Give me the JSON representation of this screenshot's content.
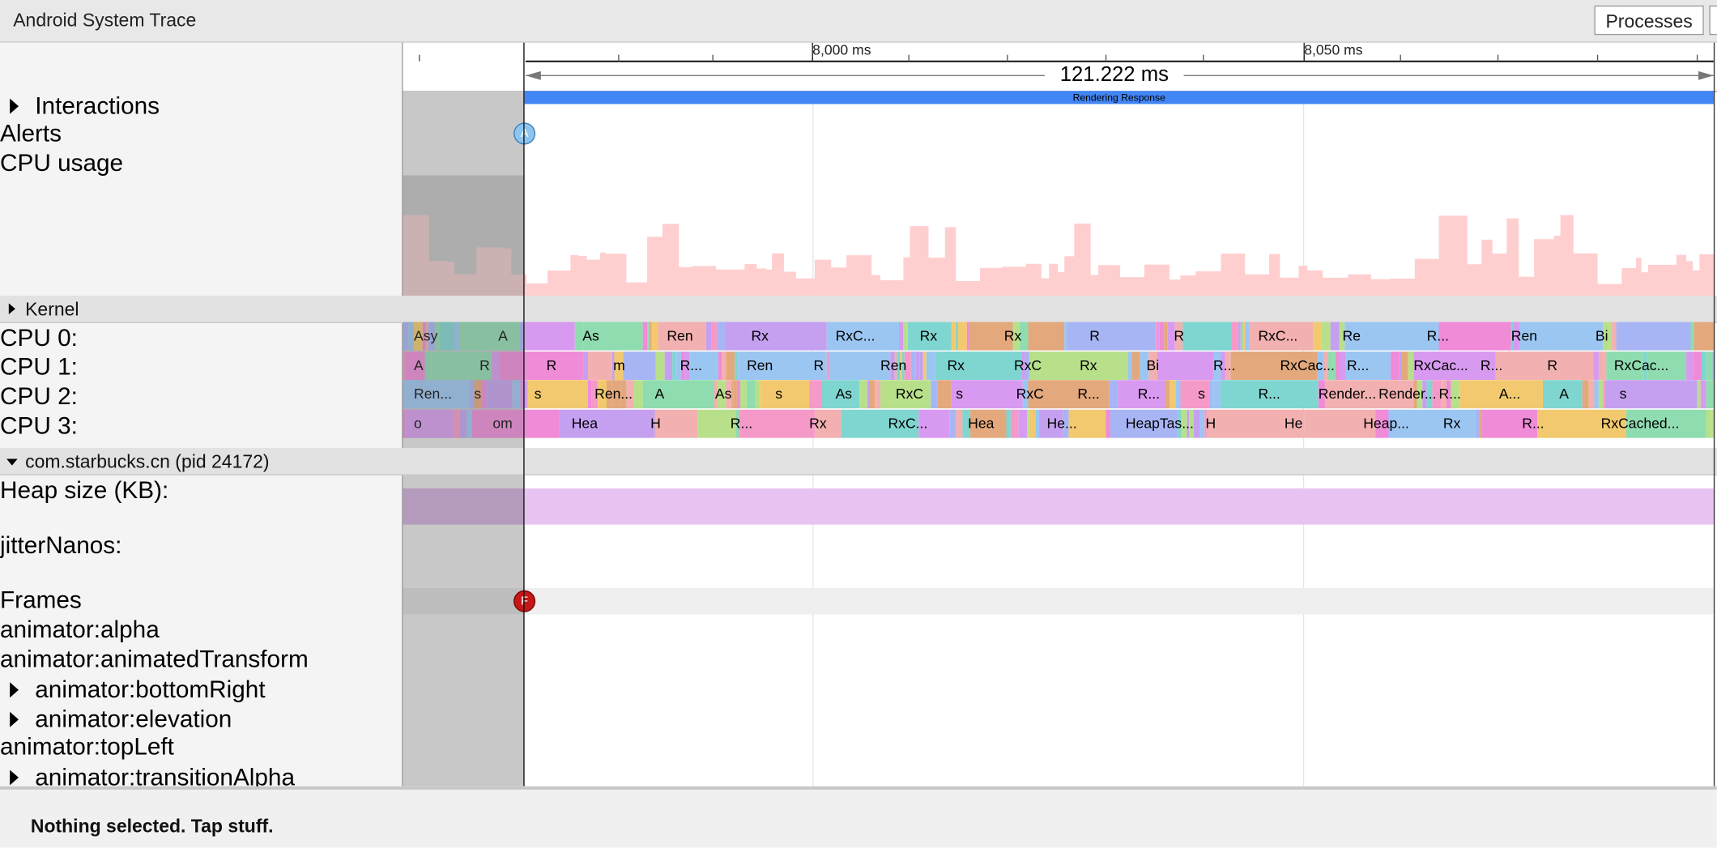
{
  "app": {
    "title": "Android System Trace",
    "processes_button": "Processes"
  },
  "ruler": {
    "ticks": [
      "8,000 ms",
      "8,050 ms"
    ],
    "selection_duration": "121.222 ms"
  },
  "interactions": {
    "label": "Interactions",
    "event_label": "Rendering Response"
  },
  "tracks": {
    "alerts": "Alerts",
    "cpu_usage": "CPU usage",
    "kernel_group": "Kernel",
    "cpu0": "CPU 0:",
    "cpu1": "CPU 1:",
    "cpu2": "CPU 2:",
    "cpu3": "CPU 3:",
    "process_group": "com.starbucks.cn (pid 24172)",
    "heap_size": "Heap size (KB):",
    "jitter": "jitterNanos:",
    "frames": "Frames",
    "anim_alpha": "animator:alpha",
    "anim_transform": "animator:animatedTransform",
    "anim_bottomright": "animator:bottomRight",
    "anim_elevation": "animator:elevation",
    "anim_topleft": "animator:topLeft",
    "anim_transitionalpha": "animator:transitionAlpha"
  },
  "markers": {
    "alert": "A",
    "frame": "F"
  },
  "cpu_slices": {
    "cpu0": [
      "Asy",
      "A",
      "As",
      "Ren",
      "Rx",
      "RxC...",
      "Rx",
      "Rx",
      "R",
      "R",
      "RxC...",
      "Re",
      "R...",
      "Ren",
      "Bi"
    ],
    "cpu1": [
      "A",
      "R",
      "R",
      "m",
      "R...",
      "Ren",
      "R",
      "Ren",
      "Rx",
      "RxC",
      "Rx",
      "Bi",
      "R...",
      "RxCac...",
      "R...",
      "RxCac...",
      "R...",
      "R",
      "RxCac..."
    ],
    "cpu2": [
      "Ren...",
      "s",
      "s",
      "Ren...",
      "A",
      "As",
      "s",
      "As",
      "RxC",
      "s",
      "RxC",
      "R...",
      "R...",
      "s",
      "R...",
      "Render...",
      "Render...",
      "R...",
      "A...",
      "A",
      "s"
    ],
    "cpu3": [
      "o",
      "om",
      "Hea",
      "H",
      "R...",
      "Rx",
      "RxC...",
      "Hea",
      "He...",
      "HeapTas...",
      "H",
      "He",
      "Heap...",
      "Rx",
      "R...",
      "RxCached..."
    ]
  },
  "colors": {
    "rendering_response": "#4285f4",
    "cpu_usage_fill": "#ffcfcf",
    "heap_fill": "#e8c3f2",
    "alert_marker": "#8ec5ef",
    "frame_marker": "#c41818"
  },
  "status": {
    "text": "Nothing selected. Tap stuff."
  }
}
